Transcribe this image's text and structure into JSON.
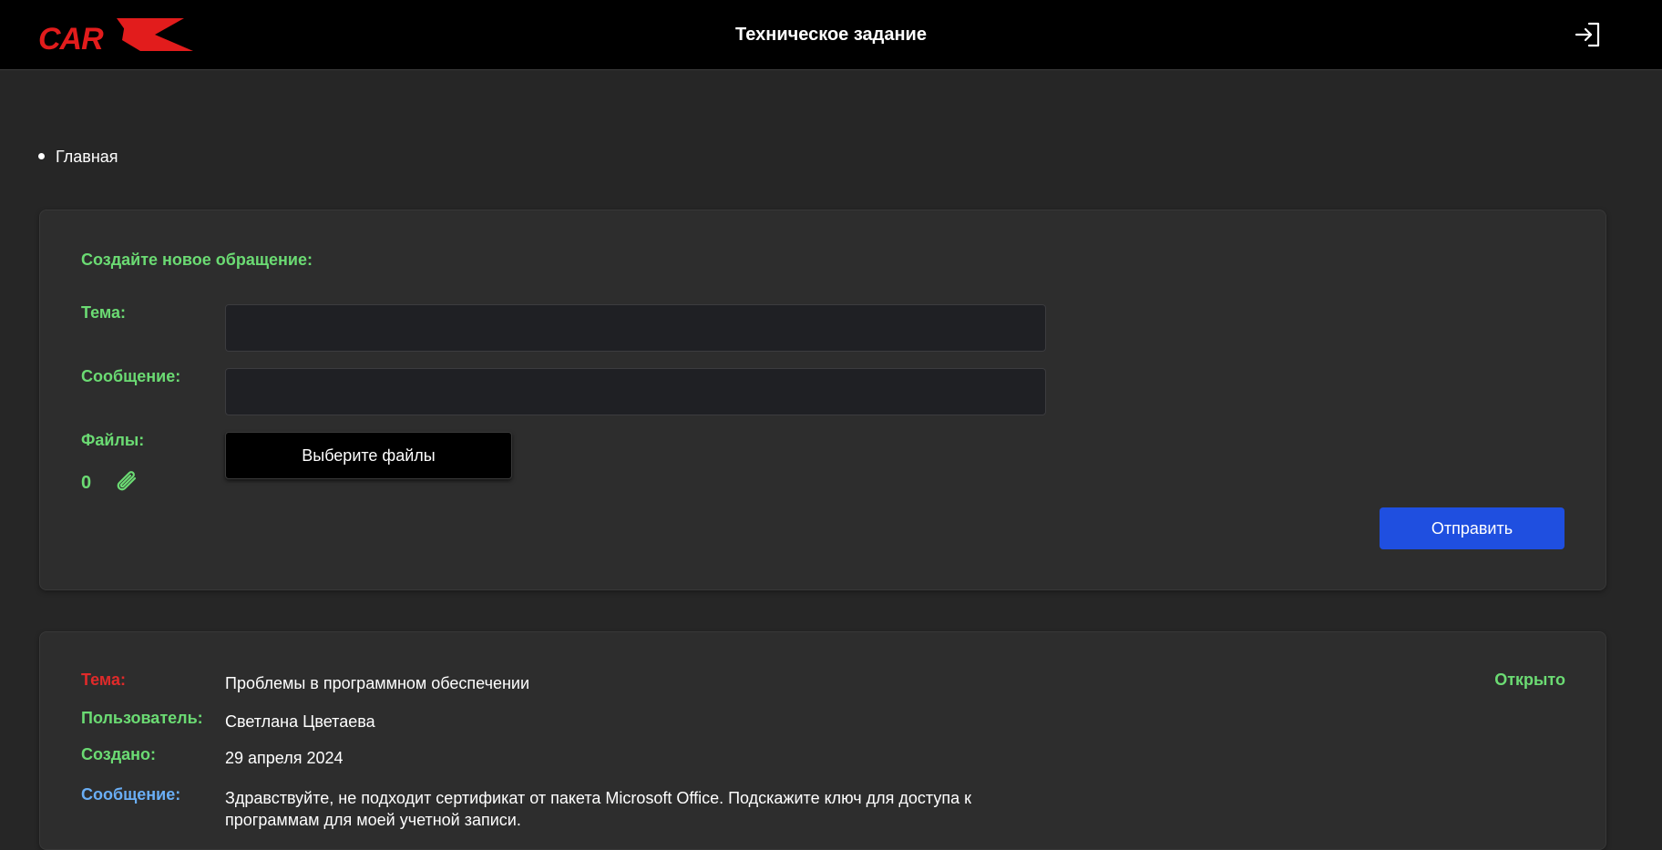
{
  "header": {
    "logo_text": "CAR",
    "title": "Техническое задание",
    "logout_icon": "logout-icon"
  },
  "breadcrumb": {
    "items": [
      "Главная"
    ]
  },
  "new_request": {
    "heading": "Создайте новое обращение:",
    "subject_label": "Тема:",
    "subject_value": "",
    "message_label": "Сообщение:",
    "message_value": "",
    "files_label": "Файлы:",
    "choose_files_label": "Выберите файлы",
    "file_count": "0",
    "attachment_icon": "paperclip-icon",
    "submit_label": "Отправить"
  },
  "ticket": {
    "subject_label": "Тема:",
    "subject_value": "Проблемы в программном обеспечении",
    "status": "Открыто",
    "user_label": "Пользователь:",
    "user_value": "Светлана Цветаева",
    "created_label": "Создано:",
    "created_value": "29 апреля 2024",
    "message_label": "Сообщение:",
    "message_value": "Здравствуйте, не подходит сертификат от пакета Microsoft Office. Подскажите ключ для доступа к программам для моей учетной записи."
  },
  "colors": {
    "background": "#262626",
    "header": "#000000",
    "card": "#2d2d2d",
    "label_green": "#6bdb73",
    "label_red": "#e02a2a",
    "label_blue": "#6aaef5",
    "accent_blue": "#1f4fe0",
    "logo_red": "#e21c1c"
  }
}
